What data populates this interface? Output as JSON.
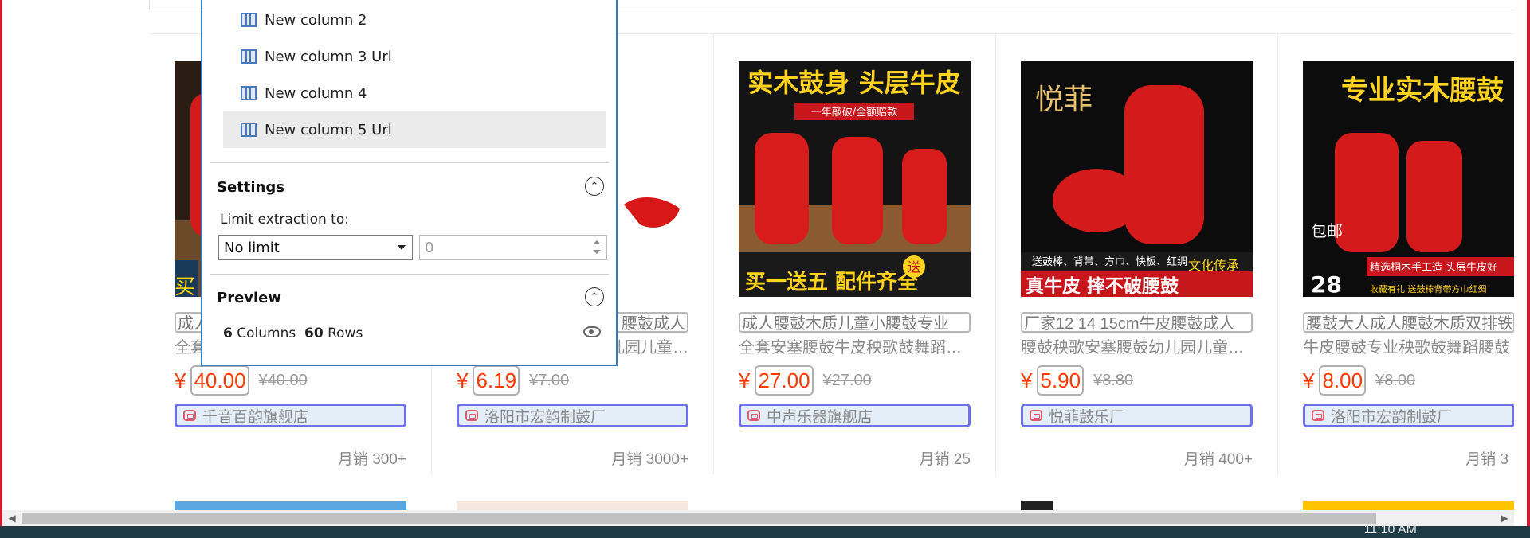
{
  "panel": {
    "columns": [
      {
        "label": "New column 2"
      },
      {
        "label": "New column 3 Url"
      },
      {
        "label": "New column 4"
      },
      {
        "label": "New column 5 Url"
      }
    ],
    "settings_title": "Settings",
    "limit_label": "Limit extraction to:",
    "limit_select_value": "No limit",
    "limit_number_value": "0",
    "preview_title": "Preview",
    "preview_columns_count": "6",
    "preview_columns_label": "Columns",
    "preview_rows_count": "60",
    "preview_rows_label": "Rows"
  },
  "products": [
    {
      "title1": "成人",
      "title2": "全套",
      "currency": "¥",
      "price": "40.00",
      "orig_price": "¥40.00",
      "shop": "千音百韵旗舰店",
      "sales": "月销 300+",
      "image_text": "买"
    },
    {
      "title1": "腰鼓成人",
      "title2": "儿园儿童…",
      "currency": "¥",
      "price": "6.19",
      "orig_price": "¥7.00",
      "shop": "洛阳市宏韵制鼓厂",
      "sales": "月销 3000+",
      "image_text": ""
    },
    {
      "title1": "成人腰鼓木质儿童小腰鼓专业",
      "title2": "全套安塞腰鼓牛皮秧歌鼓舞蹈…",
      "currency": "¥",
      "price": "27.00",
      "orig_price": "¥27.00",
      "shop": "中声乐器旗舰店",
      "sales": "月销 25",
      "image_text": "实木鼓身 头层牛皮",
      "image_sub": "一年敲破/全额赔款",
      "image_bottom": "买一送五 配件齐全",
      "image_tag": "送"
    },
    {
      "title1": "厂家12 14 15cm牛皮腰鼓成人",
      "title2": "腰鼓秧歌安塞腰鼓幼儿园儿童…",
      "currency": "¥",
      "price": "5.90",
      "orig_price": "¥8.80",
      "shop": "悦菲鼓乐厂",
      "sales": "月销 400+",
      "image_text": "悦菲",
      "image_sub": "送鼓棒、背带、方巾、快板、红绸",
      "image_bottom": "真牛皮 摔不破腰鼓",
      "image_tag": "文化传承"
    },
    {
      "title1": "腰鼓大人成人腰鼓木质双排铁",
      "title2": "牛皮腰鼓专业秧歌鼓舞蹈腰鼓",
      "currency": "¥",
      "price": "8.00",
      "orig_price": "¥8.00",
      "shop": "洛阳市宏韵制鼓厂",
      "sales": "月销 3",
      "image_text": "专业实木腰鼓",
      "image_sub": "精选桐木手工造 头层牛皮好",
      "image_bottom": "收藏有礼 送鼓棒背带方巾红绸",
      "image_tag": "包邮",
      "image_price": "28"
    }
  ],
  "taskbar": {
    "clock": "11:10 AM"
  },
  "colors": {
    "accent_red": "#ff3a00",
    "panel_border": "#2f7bc9",
    "shop_border": "#6f6ff0",
    "frame": "#d01c34"
  }
}
